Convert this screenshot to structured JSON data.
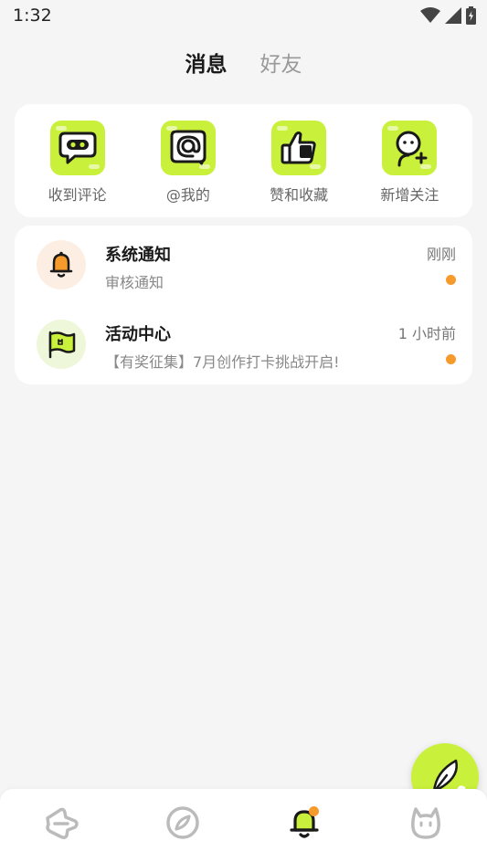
{
  "status_bar": {
    "time": "1:32",
    "icons": [
      "wifi-icon",
      "signal-icon",
      "battery-icon"
    ]
  },
  "tabs": [
    {
      "label": "消息",
      "active": true
    },
    {
      "label": "好友",
      "active": false
    }
  ],
  "quick_actions": [
    {
      "label": "收到评论",
      "icon": "comment-icon"
    },
    {
      "label": "@我的",
      "icon": "mention-icon"
    },
    {
      "label": "赞和收藏",
      "icon": "thumbs-up-icon"
    },
    {
      "label": "新增关注",
      "icon": "new-follower-icon"
    }
  ],
  "messages": [
    {
      "title": "系统通知",
      "subtitle": "审核通知",
      "time": "刚刚",
      "icon": "bell-icon",
      "unread": true
    },
    {
      "title": "活动中心",
      "subtitle": "【有奖征集】7月创作打卡挑战开启!",
      "time": "1 小时前",
      "icon": "flag-icon",
      "unread": true
    }
  ],
  "fab": {
    "icon": "feather-pen-icon"
  },
  "bottom_nav": [
    {
      "icon": "home-icon",
      "active": false
    },
    {
      "icon": "compass-icon",
      "active": false
    },
    {
      "icon": "bell-icon",
      "active": true,
      "badge": true
    },
    {
      "icon": "profile-cat-icon",
      "active": false
    }
  ],
  "colors": {
    "accent": "#c9f03a",
    "badge": "#f79a2c",
    "background": "#f5f5f5"
  }
}
